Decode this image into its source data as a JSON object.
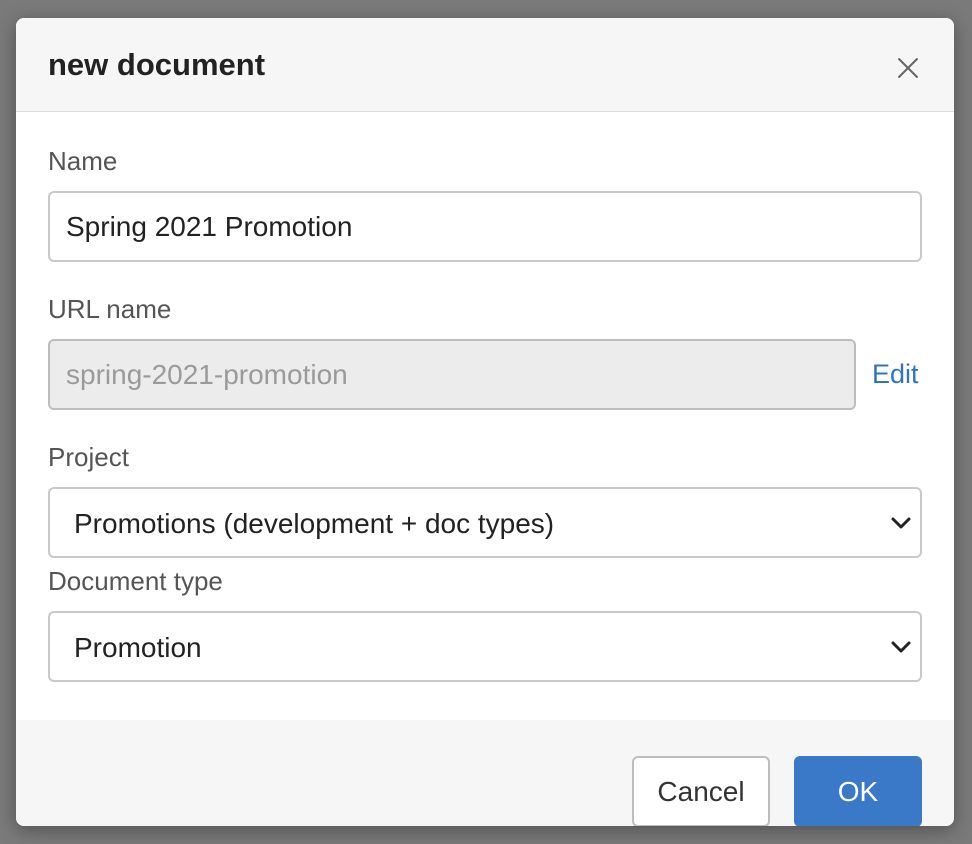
{
  "dialog": {
    "title": "new document",
    "close_icon": "close-icon"
  },
  "fields": {
    "name": {
      "label": "Name",
      "value": "Spring 2021 Promotion"
    },
    "url_name": {
      "label": "URL name",
      "value": "spring-2021-promotion",
      "edit_label": "Edit"
    },
    "project": {
      "label": "Project",
      "selected": "Promotions (development + doc types)"
    },
    "document_type": {
      "label": "Document type",
      "selected": "Promotion"
    }
  },
  "footer": {
    "cancel_label": "Cancel",
    "ok_label": "OK"
  },
  "colors": {
    "accent": "#3a78c8",
    "link": "#2f74c0"
  }
}
